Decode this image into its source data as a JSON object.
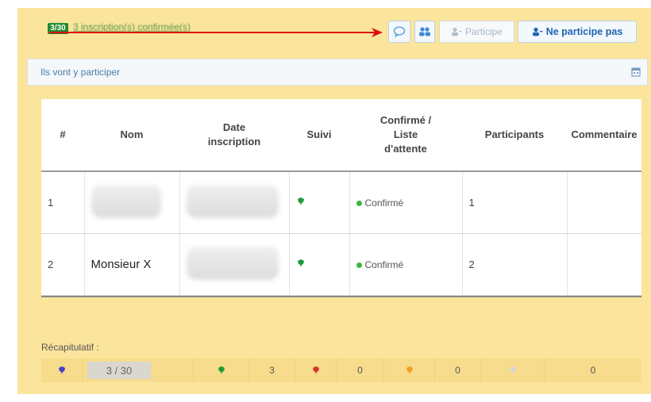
{
  "header": {
    "count_badge": "3/30",
    "count_text": "3 inscription(s) confirmée(s)"
  },
  "toolbar": {
    "comment_icon": "speech-bubble-icon",
    "group_icon": "users-icon",
    "participe_label": "Participe",
    "not_participate_label": "Ne participe pas"
  },
  "section": {
    "title": "Ils vont y participer",
    "icon": "calendar-icon"
  },
  "table": {
    "headers": {
      "num": "#",
      "nom": "Nom",
      "date_line1": "Date",
      "date_line2": "inscription",
      "suivi": "Suivi",
      "conf_line1": "Confirmé /",
      "conf_line2": "Liste",
      "conf_line3": "d'attente",
      "participants": "Participants",
      "commentaire": "Commentaire"
    },
    "rows": [
      {
        "num": "1",
        "nom": "",
        "status": "Confirmé",
        "participants": "1",
        "commentaire": ""
      },
      {
        "num": "2",
        "nom": "Monsieur X",
        "status": "Confirmé",
        "participants": "2",
        "commentaire": ""
      }
    ]
  },
  "summary": {
    "label": "Récapitulatif :",
    "total": "3 / 30",
    "green_count": "3",
    "red_count": "0",
    "orange_count": "0",
    "grey_count": "0"
  },
  "colors": {
    "panel_bg": "#fbe49b",
    "confirm_green": "#3fb443",
    "accent_blue": "#1e64b4",
    "arrow_red": "#e01010"
  }
}
